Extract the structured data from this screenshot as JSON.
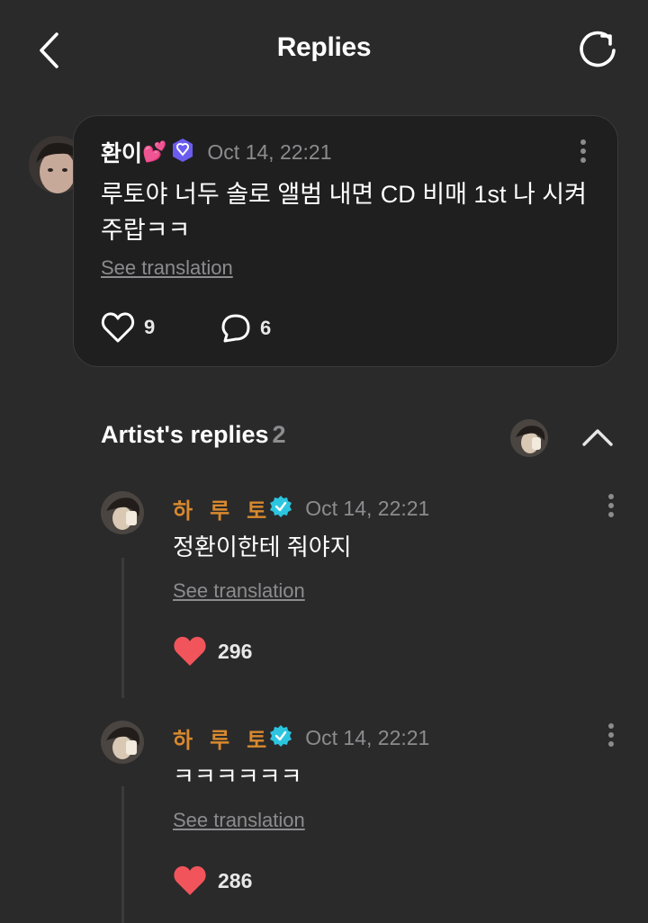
{
  "header": {
    "title": "Replies"
  },
  "comment": {
    "author": "환이",
    "author_emoji": "💕",
    "timestamp": "Oct 14, 22:21",
    "text": "루토야 너두 솔로 앨범 내면 CD 비매 1st 나 시켜주랍ㅋㅋ",
    "see_translation": "See translation",
    "likes": "9",
    "replies": "6"
  },
  "artist_replies": {
    "title": "Artist's replies",
    "count": "2",
    "items": [
      {
        "author": "하루토",
        "timestamp": "Oct 14, 22:21",
        "text": "정환이한테 줘야지",
        "see_translation": "See translation",
        "likes": "296"
      },
      {
        "author": "하루토",
        "timestamp": "Oct 14, 22:21",
        "text": "ㅋㅋㅋㅋㅋㅋ",
        "see_translation": "See translation",
        "likes": "286"
      }
    ]
  },
  "colors": {
    "background": "#2a2a2b",
    "card": "#1f1f20",
    "artist_name": "#d9892e",
    "verified_badge": "#2cc5e0",
    "fan_badge": "#6b5cf0",
    "like_filled": "#f2545b",
    "muted_text": "#8c8c8e"
  },
  "icons": {
    "back": "chevron-left-icon",
    "refresh": "refresh-icon",
    "more": "more-vertical-icon",
    "like": "heart-outline-icon",
    "reply": "comment-bubble-icon",
    "liked": "heart-filled-icon",
    "collapse": "chevron-up-icon",
    "verified": "verified-badge-icon"
  }
}
